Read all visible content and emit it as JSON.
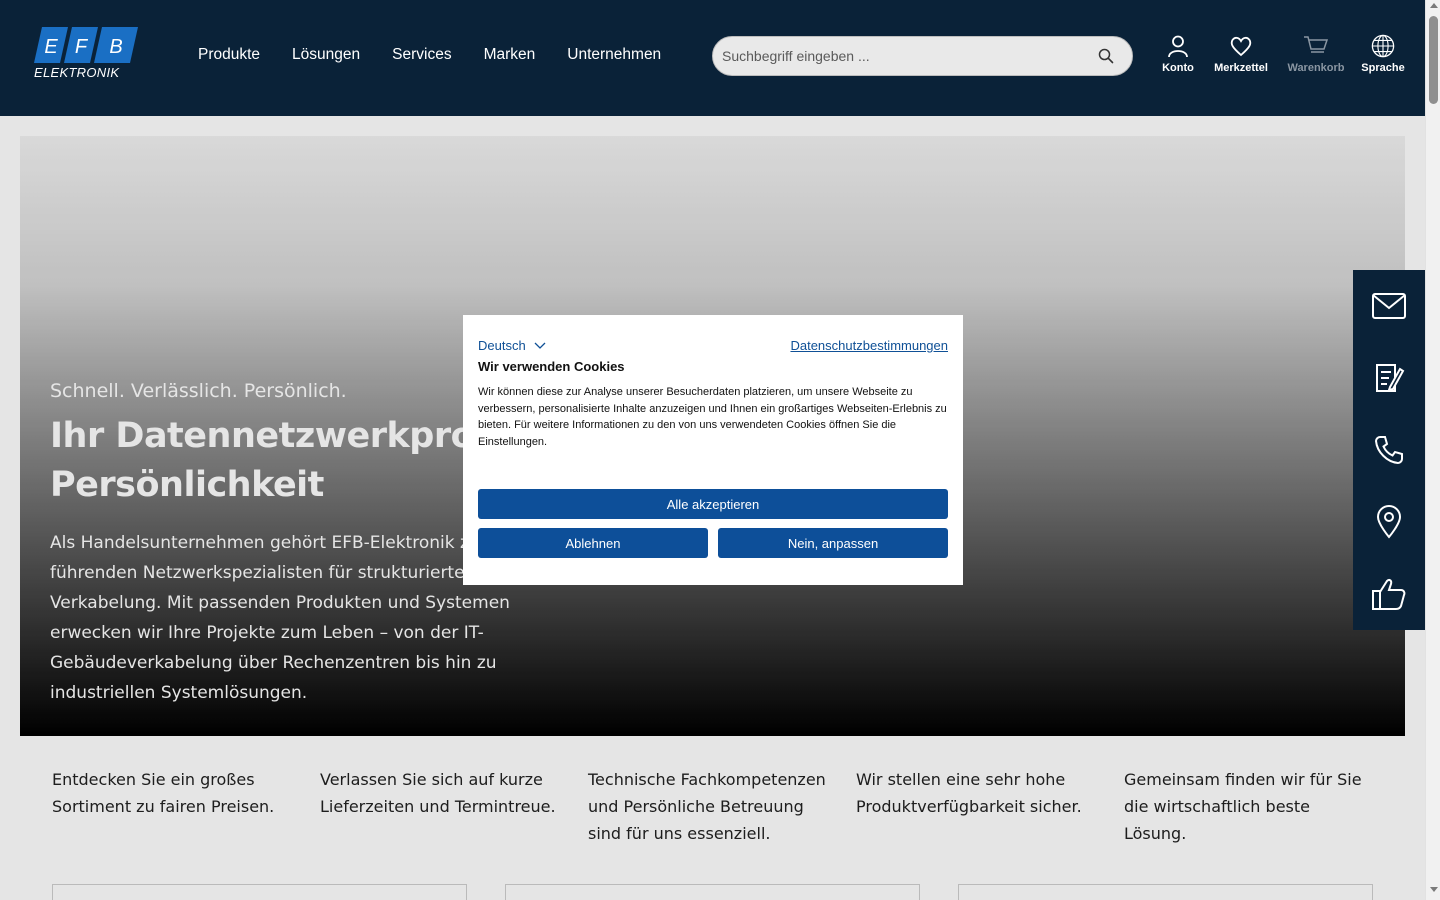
{
  "brand": {
    "logo_letters": [
      "E",
      "F",
      "B"
    ],
    "logo_word": "ELEKTRONIK",
    "colors": {
      "header_bg": "#0a2238",
      "logo_blue": "#1a6fc4",
      "button_blue": "#0d4f99",
      "link_blue": "#0f5096"
    }
  },
  "nav": {
    "items": [
      "Produkte",
      "Lösungen",
      "Services",
      "Marken",
      "Unternehmen"
    ]
  },
  "search": {
    "placeholder": "Suchbegriff eingeben ...",
    "icon": "search-icon"
  },
  "header_actions": [
    {
      "label": "Konto",
      "icon": "user-icon"
    },
    {
      "label": "Merkzettel",
      "icon": "heart-icon"
    },
    {
      "label": "Warenkorb",
      "icon": "cart-icon",
      "disabled": true
    },
    {
      "label": "Sprache",
      "icon": "globe-icon"
    }
  ],
  "hero": {
    "kicker": "Schnell. Verlässlich. Persönlich.",
    "title": "Ihr Datennetzwerkprofi mit Persönlichkeit",
    "text": "Als Handelsunternehmen gehört EFB-Elektronik zu den führenden Netzwerkspezialisten für strukturierte Verkabelung. Mit passenden Produkten und Systemen erwecken wir Ihre Projekte zum Leben – von der IT-Gebäudeverkabelung über Rechenzentren bis hin zu industriellen Systemlösungen."
  },
  "features": [
    "Entdecken Sie ein großes Sortiment zu fairen Preisen.",
    "Verlassen Sie sich auf kurze Lieferzeiten und Termintreue.",
    "Technische Fachkompetenzen und Persönliche Betreuung sind für uns essenziell.",
    "Wir stellen eine sehr hohe Produktverfügbarkeit sicher.",
    "Gemeinsam finden wir für Sie die wirtschaftlich beste Lösung."
  ],
  "sidebar": {
    "icons": [
      "mail-icon",
      "form-icon",
      "phone-icon",
      "location-icon",
      "thumbs-up-icon"
    ]
  },
  "cookie": {
    "language": "Deutsch",
    "privacy_link": "Datenschutzbestimmungen",
    "title": "Wir verwenden Cookies",
    "text": "Wir können diese zur Analyse unserer Besucherdaten platzieren, um unsere Webseite zu verbessern, personalisierte Inhalte anzuzeigen und Ihnen ein großartiges Webseiten-Erlebnis zu bieten. Für weitere Informationen zu den von uns verwendeten Cookies öffnen Sie die Einstellungen.",
    "accept_all": "Alle akzeptieren",
    "decline": "Ablehnen",
    "customize": "Nein, anpassen"
  }
}
